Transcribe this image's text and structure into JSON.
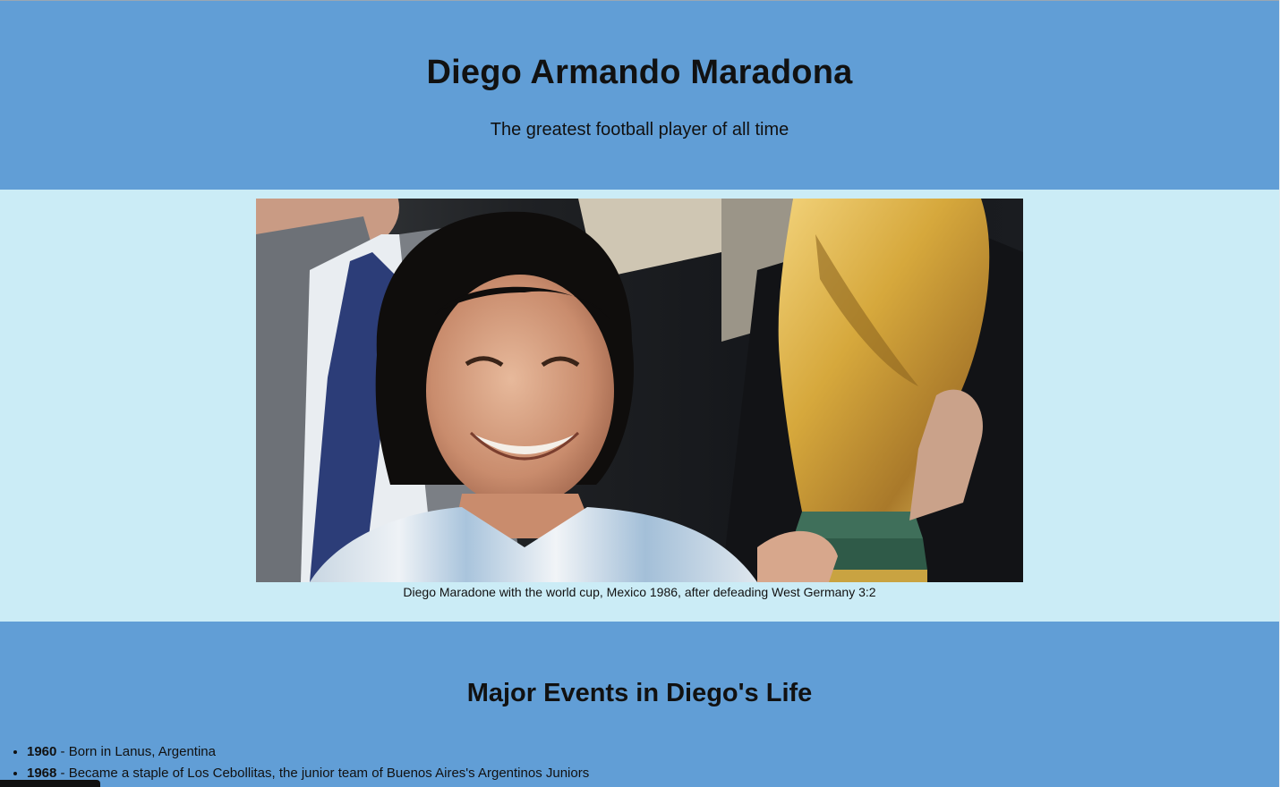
{
  "header": {
    "title": "Diego Armando Maradona",
    "tagline": "The greatest football player of all time"
  },
  "image": {
    "caption": "Diego Maradone with the world cup, Mexico 1986, after defeading West Germany 3:2"
  },
  "timeline": {
    "heading": "Major Events in Diego's Life",
    "events": [
      {
        "year": "1960",
        "text": " - Born in Lanus, Argentina"
      },
      {
        "year": "1968",
        "text": " - Became a staple of Los Cebollitas, the junior team of Buenos Aires's Argentinos Juniors"
      }
    ]
  },
  "colors": {
    "band_blue": "#619ed6",
    "band_light": "#cbecf6"
  }
}
